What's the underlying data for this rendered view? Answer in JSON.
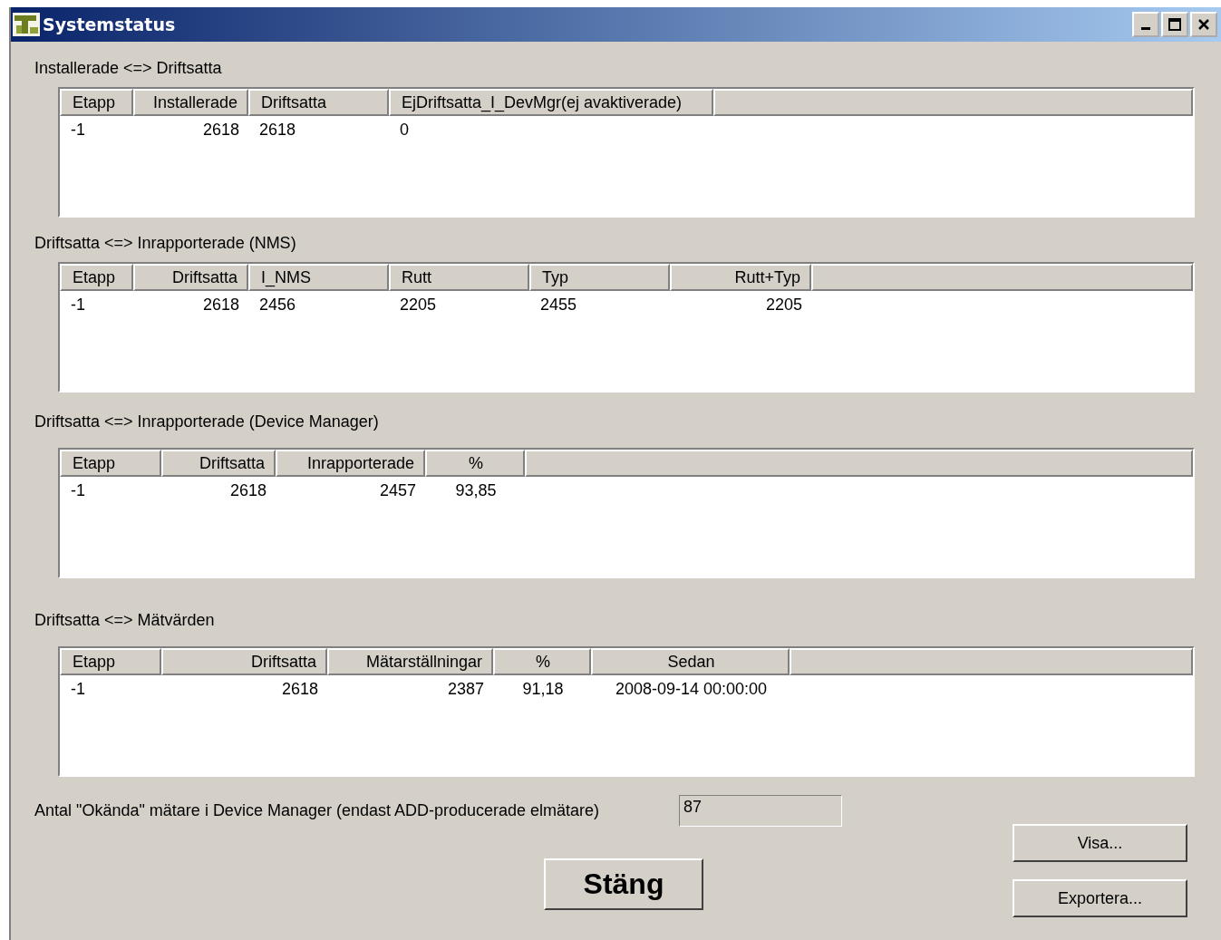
{
  "window": {
    "title": "Systemstatus"
  },
  "sections": [
    {
      "title": "Installerade <=> Driftsatta",
      "columns": [
        {
          "label": "Etapp",
          "kind": "text"
        },
        {
          "label": "Installerade",
          "kind": "number"
        },
        {
          "label": "Driftsatta",
          "kind": "text"
        },
        {
          "label": "EjDriftsatta_I_DevMgr(ej avaktiverade)",
          "kind": "text"
        }
      ],
      "rows": [
        [
          "-1",
          "2618",
          "2618",
          "0"
        ]
      ]
    },
    {
      "title": "Driftsatta <=> Inrapporterade (NMS)",
      "columns": [
        {
          "label": "Etapp",
          "kind": "text"
        },
        {
          "label": "Driftsatta",
          "kind": "number"
        },
        {
          "label": "I_NMS",
          "kind": "text"
        },
        {
          "label": "Rutt",
          "kind": "text"
        },
        {
          "label": "Typ",
          "kind": "text"
        },
        {
          "label": "Rutt+Typ",
          "kind": "number"
        }
      ],
      "rows": [
        [
          "-1",
          "2618",
          "2456",
          "2205",
          "2455",
          "2205"
        ]
      ]
    },
    {
      "title": "Driftsatta <=> Inrapporterade (Device Manager)",
      "columns": [
        {
          "label": "Etapp",
          "kind": "text"
        },
        {
          "label": "Driftsatta",
          "kind": "number"
        },
        {
          "label": "Inrapporterade",
          "kind": "number"
        },
        {
          "label": "%",
          "kind": "percent"
        }
      ],
      "rows": [
        [
          "-1",
          "2618",
          "2457",
          "93,85"
        ]
      ]
    },
    {
      "title": "Driftsatta <=> Mätvärden",
      "columns": [
        {
          "label": "Etapp",
          "kind": "text"
        },
        {
          "label": "Driftsatta",
          "kind": "number"
        },
        {
          "label": "Mätarställningar",
          "kind": "number"
        },
        {
          "label": "%",
          "kind": "percent"
        },
        {
          "label": "Sedan",
          "kind": "date"
        }
      ],
      "rows": [
        [
          "-1",
          "2618",
          "2387",
          "91,18",
          "2008-09-14 00:00:00"
        ]
      ]
    }
  ],
  "unknown_meters": {
    "label": "Antal \"Okända\" mätare i Device Manager (endast ADD-producerade elmätare)",
    "value": "87"
  },
  "buttons": {
    "close": "Stäng",
    "show": "Visa...",
    "export": "Exportera..."
  }
}
